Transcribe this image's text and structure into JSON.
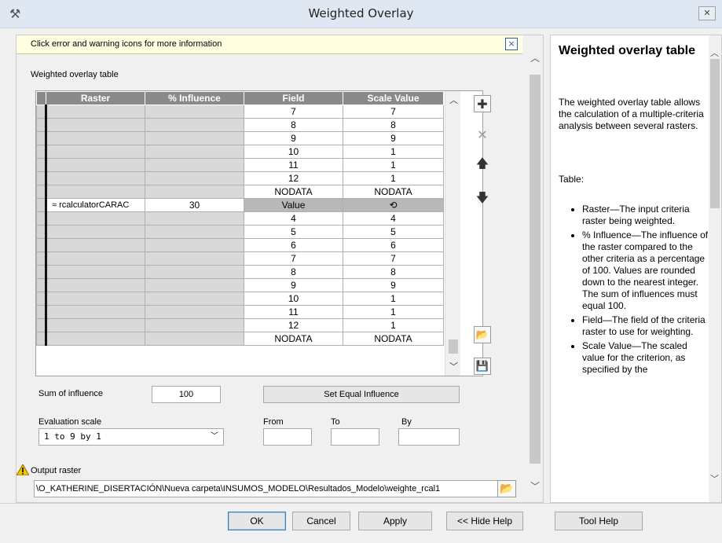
{
  "window": {
    "title": "Weighted Overlay",
    "close_glyph": "✕",
    "app_icon": "hammer-icon"
  },
  "infobar": {
    "text": "Click error and warning icons for more information",
    "close_glyph": "×"
  },
  "table_label": "Weighted overlay table",
  "table": {
    "headers": [
      "Raster",
      "% Influence",
      "Field",
      "Scale Value"
    ],
    "rows": [
      {
        "raster": "",
        "influence": "",
        "field": "7",
        "scale": "7"
      },
      {
        "raster": "",
        "influence": "",
        "field": "8",
        "scale": "8"
      },
      {
        "raster": "",
        "influence": "",
        "field": "9",
        "scale": "9"
      },
      {
        "raster": "",
        "influence": "",
        "field": "10",
        "scale": "1"
      },
      {
        "raster": "",
        "influence": "",
        "field": "11",
        "scale": "1"
      },
      {
        "raster": "",
        "influence": "",
        "field": "12",
        "scale": "1"
      },
      {
        "raster": "",
        "influence": "",
        "field": "NODATA",
        "scale": "NODATA"
      },
      {
        "raster": "≈ rcalculatorCARAC",
        "influence": "30",
        "field": "Value",
        "scale": "⟲"
      },
      {
        "raster": "",
        "influence": "",
        "field": "4",
        "scale": "4"
      },
      {
        "raster": "",
        "influence": "",
        "field": "5",
        "scale": "5"
      },
      {
        "raster": "",
        "influence": "",
        "field": "6",
        "scale": "6"
      },
      {
        "raster": "",
        "influence": "",
        "field": "7",
        "scale": "7"
      },
      {
        "raster": "",
        "influence": "",
        "field": "8",
        "scale": "8"
      },
      {
        "raster": "",
        "influence": "",
        "field": "9",
        "scale": "9"
      },
      {
        "raster": "",
        "influence": "",
        "field": "10",
        "scale": "1"
      },
      {
        "raster": "",
        "influence": "",
        "field": "11",
        "scale": "1"
      },
      {
        "raster": "",
        "influence": "",
        "field": "12",
        "scale": "1"
      },
      {
        "raster": "",
        "influence": "",
        "field": "NODATA",
        "scale": "NODATA"
      }
    ]
  },
  "tools": {
    "add": "✚",
    "remove": "✕",
    "up": "🡅",
    "down": "🡇",
    "open": "📂",
    "save": "💾"
  },
  "sum_label": "Sum of influence",
  "sum_value": "100",
  "equal_button": "Set Equal Influence",
  "eval_label": "Evaluation scale",
  "eval_value": "1  to  9  by  1",
  "from_label": "From",
  "to_label": "To",
  "by_label": "By",
  "output_label": "Output raster",
  "output_value": "\\O_KATHERINE_DISERTACIÓN\\Nueva carpeta\\INSUMOS_MODELO\\Resultados_Modelo\\weighte_rcal1",
  "help": {
    "title": "Weighted overlay table",
    "intro": "The weighted overlay table allows the calculation of a multiple-criteria analysis between several rasters.",
    "table_heading": "Table:",
    "bullets": [
      "Raster—The input criteria raster being weighted.",
      "% Influence—The influence of the raster compared to the other criteria as a percentage of 100. Values are rounded down to the nearest integer. The sum of influences must equal 100.",
      "Field—The field of the criteria raster to use for weighting.",
      "Scale Value—The scaled value for the criterion, as specified by the"
    ]
  },
  "footer": {
    "ok": "OK",
    "cancel": "Cancel",
    "apply": "Apply",
    "hide_help": "<< Hide Help",
    "tool_help": "Tool Help"
  }
}
